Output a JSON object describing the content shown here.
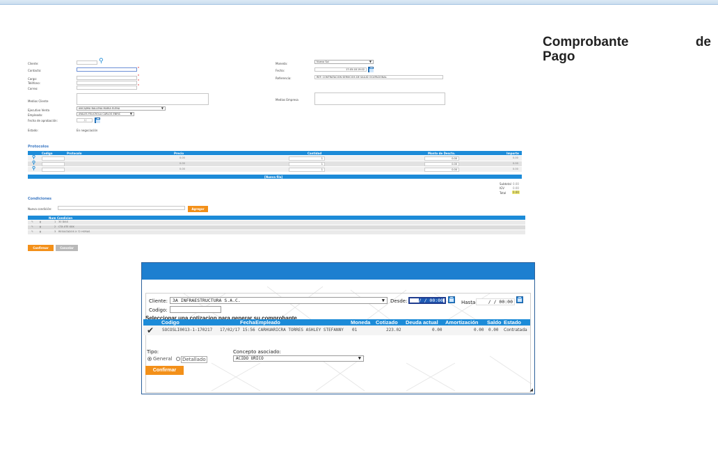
{
  "page": {
    "title_line1_a": "Comprobante",
    "title_line1_b": "de",
    "title_line2": "Pago"
  },
  "bg_form": {
    "labels": {
      "cliente": "Cliente:",
      "contacto": "Contacto:",
      "cargo": "Cargo:",
      "telefono": "Teléfono:",
      "correo": "Correo:",
      "medios_cliente": "Medios Cliente",
      "ejecutivo": "Ejecutivo Venta",
      "empleado": "Empleado:",
      "fecha_aprob": "Fecha de aprobación:",
      "estado": "Estado:",
      "moneda": "Moneda:",
      "fecha": "Fecha:",
      "referencia": "Referencia:",
      "medios_empresa": "Medios Empresa"
    },
    "values": {
      "ejecutivo": "ANCAJIMA BALLENA MARIA ELENA",
      "empleado": "AYALES FELICROLA CARLOS ENRIC",
      "fecha_aprob": "/ /",
      "estado": "En negociación",
      "moneda": "Nuevo Sol",
      "fecha": "17:05:18 19:02",
      "referencia": "REF: CONTRATACIÓN SERVICIOS DE SALUD OCUPACIONAL"
    },
    "protocolos": {
      "title": "Protocolos",
      "headers": [
        "Codigo",
        "Protocolo",
        "Precio",
        "Cantidad",
        "Monto de Descto.",
        "Importe"
      ],
      "rows": [
        {
          "precio": "0.00",
          "cantidad": "1",
          "descto": "0.00",
          "importe": "0.00"
        },
        {
          "precio": "0.00",
          "cantidad": "1",
          "descto": "0.00",
          "importe": "0.00"
        },
        {
          "precio": "0.00",
          "cantidad": "1",
          "descto": "0.00",
          "importe": "0.00"
        }
      ],
      "nueva_fila": "[Nueva fila]",
      "totals": {
        "subtotal_label": "Subtotal",
        "subtotal": "0.00",
        "igv_label": "IGV",
        "igv": "0.00",
        "total_label": "Total",
        "total": "0.00"
      }
    },
    "condiciones": {
      "title": "Condiciones",
      "nueva_label": "Nueva condición:",
      "agregar": "Agregar",
      "headers": [
        "Num",
        "Condicion"
      ],
      "rows": [
        {
          "num": "1",
          "text": "30 DIAS"
        },
        {
          "num": "2",
          "text": "CTA XTE XXX"
        },
        {
          "num": "3",
          "text": "RESULTADOS X 72 HORAS"
        }
      ]
    },
    "buttons": {
      "confirmar": "Confirmar",
      "cancelar": "Cancelar"
    }
  },
  "dialog": {
    "cliente_label": "Cliente:",
    "cliente_value": "3A INFRAESTRUCTURA S.A.C.",
    "desde_label": "Desde:",
    "desde_value": "/ / 00:00",
    "hasta_label": "Hasta:",
    "hasta_value": "/ / 00:00",
    "codigo_label": "Codigo:",
    "codigo_value": "",
    "select_title": "Seleccionar una cotizacion para generar su comprobante",
    "table_headers": {
      "codigo": "Codigo",
      "fecha": "Fecha",
      "empleado": "Empleado",
      "moneda": "Moneda",
      "cotizado": "Cotizado",
      "deuda": "Deuda actual",
      "amort": "Amortización",
      "saldo": "Saldo",
      "estado": "Estado"
    },
    "row": {
      "codigo": "SOCOSLI0013-1-170217",
      "fecha": "17/02/17 15:56",
      "empleado": "CARHUARICRA TORRES ASHLEY STEFANNY",
      "moneda": "01",
      "cotizado": "223.02",
      "deuda": "0.00",
      "amort": "0.00",
      "saldo": "0.00",
      "estado": "Contratada"
    },
    "tipo_label": "Tipo:",
    "tipo_general": "General",
    "tipo_detallado": "Detallado",
    "concepto_label": "Concepto asociado:",
    "concepto_value": "ACIDO URICO",
    "confirmar": "Confirmar"
  }
}
